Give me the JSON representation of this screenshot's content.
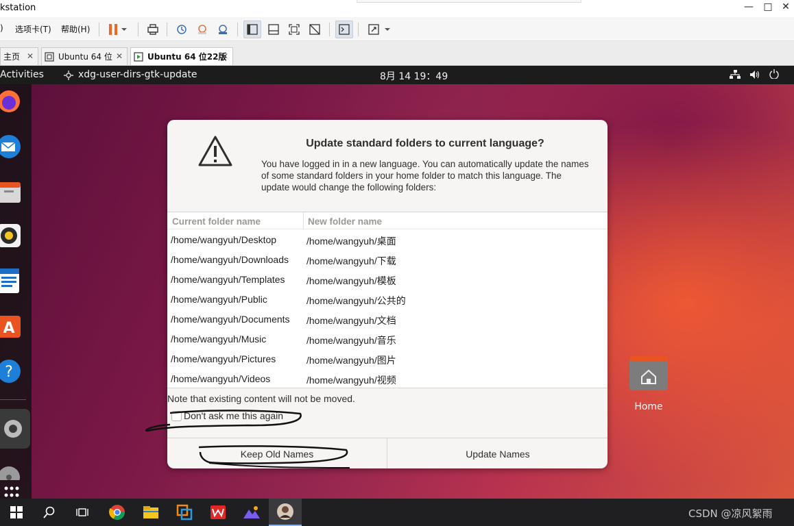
{
  "window": {
    "title": "kstation",
    "controls": [
      "—",
      "□",
      "✕"
    ]
  },
  "menubar": {
    "items": [
      ")",
      "选项卡(T)",
      "帮助(H)"
    ]
  },
  "tabs": [
    {
      "label": "主页",
      "active": false
    },
    {
      "label": "Ubuntu 64 位",
      "active": false
    },
    {
      "label": "Ubuntu 64 位22版",
      "active": true
    }
  ],
  "ubuntu_topbar": {
    "activities": "Activities",
    "app_name": "xdg-user-dirs-gtk-update",
    "clock": "8月 14  19：49"
  },
  "dialog": {
    "title": "Update standard folders to current language?",
    "body": "You have logged in in a new language. You can automatically update the names of some standard folders in your home folder to match this language. The update would change the following folders:",
    "columns": [
      "Current folder name",
      "New folder name"
    ],
    "rows": [
      [
        "/home/wangyuh/Desktop",
        "/home/wangyuh/桌面"
      ],
      [
        "/home/wangyuh/Downloads",
        "/home/wangyuh/下载"
      ],
      [
        "/home/wangyuh/Templates",
        "/home/wangyuh/模板"
      ],
      [
        "/home/wangyuh/Public",
        "/home/wangyuh/公共的"
      ],
      [
        "/home/wangyuh/Documents",
        "/home/wangyuh/文档"
      ],
      [
        "/home/wangyuh/Music",
        "/home/wangyuh/音乐"
      ],
      [
        "/home/wangyuh/Pictures",
        "/home/wangyuh/图片"
      ],
      [
        "/home/wangyuh/Videos",
        "/home/wangyuh/视频"
      ]
    ],
    "note": "Note that existing content will not be moved.",
    "checkbox_label": "Don't ask me this again",
    "checkbox_checked": false,
    "keep_button": "Keep Old Names",
    "update_button": "Update Names"
  },
  "desktop": {
    "home_label": "Home"
  },
  "watermark": "CSDN @凉风絮雨",
  "colors": {
    "accent": "#e95420",
    "dialog_bg": "#f6f5f4",
    "topbar_bg": "#1c1c1c"
  }
}
